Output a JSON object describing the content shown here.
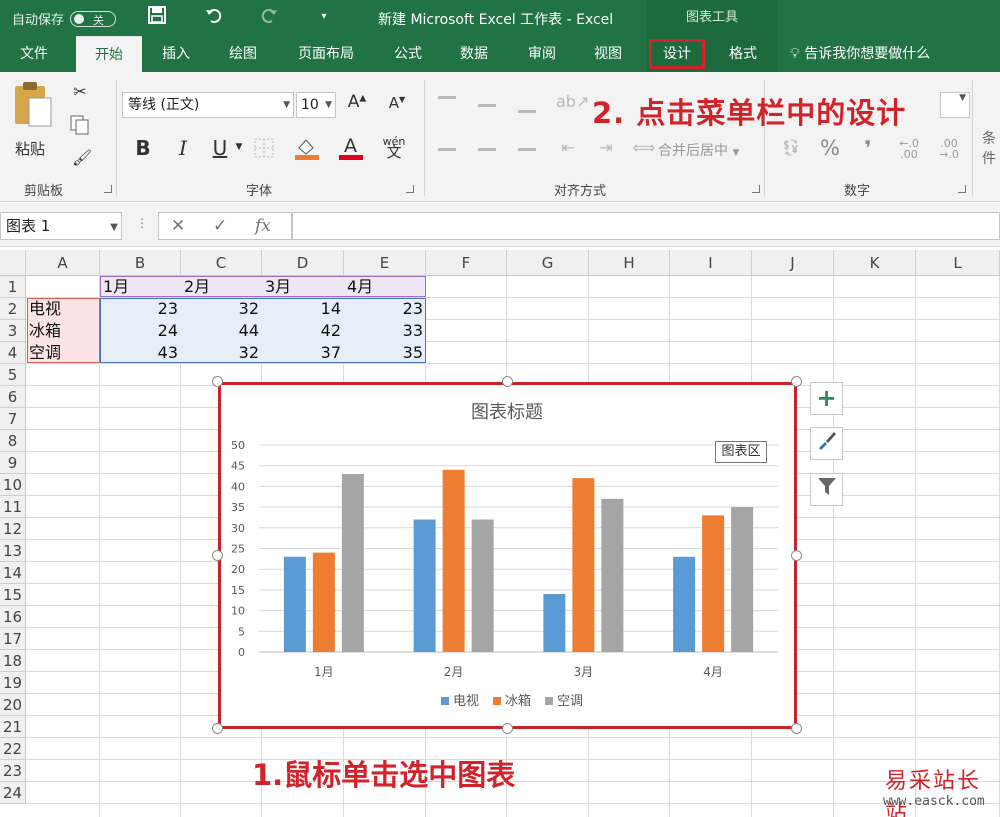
{
  "titlebar": {
    "autosave_label": "自动保存",
    "autosave_state": "关",
    "title": "新建 Microsoft Excel 工作表  -  Excel",
    "context_tools": "图表工具"
  },
  "menu": {
    "tabs": [
      "文件",
      "开始",
      "插入",
      "绘图",
      "页面布局",
      "公式",
      "数据",
      "审阅",
      "视图",
      "设计",
      "格式"
    ],
    "tell_me": "告诉我你想要做什么"
  },
  "ribbon": {
    "clipboard": {
      "paste": "粘贴",
      "label": "剪贴板"
    },
    "font": {
      "name": "等线 (正文)",
      "size": "10",
      "bold": "B",
      "italic": "I",
      "underline": "U",
      "phonetic": "wén",
      "phonetic_sub": "文",
      "label": "字体"
    },
    "alignment": {
      "merge": "合并后居中",
      "label": "对齐方式"
    },
    "number": {
      "percent": "%",
      "comma": "❜",
      "label": "数字"
    },
    "styles_partial": "条件"
  },
  "annotation_2": "2. 点击菜单栏中的设计",
  "formula_bar": {
    "name_box": "图表 1",
    "fx": "fx"
  },
  "grid": {
    "columns": [
      "A",
      "B",
      "C",
      "D",
      "E",
      "F",
      "G",
      "H",
      "I",
      "J",
      "K",
      "L"
    ],
    "rows": [
      "1",
      "2",
      "3",
      "4",
      "5",
      "6",
      "7",
      "8",
      "9",
      "10",
      "11",
      "12",
      "13",
      "14",
      "15",
      "16",
      "17",
      "18",
      "19",
      "20",
      "21",
      "22",
      "23",
      "24"
    ],
    "header_row": [
      "1月",
      "2月",
      "3月",
      "4月"
    ],
    "data_rows": [
      {
        "label": "电视",
        "values": [
          23,
          32,
          14,
          23
        ]
      },
      {
        "label": "冰箱",
        "values": [
          24,
          44,
          42,
          33
        ]
      },
      {
        "label": "空调",
        "values": [
          43,
          32,
          37,
          35
        ]
      }
    ]
  },
  "chart_data": {
    "type": "bar",
    "title": "图表标题",
    "categories": [
      "1月",
      "2月",
      "3月",
      "4月"
    ],
    "series": [
      {
        "name": "电视",
        "values": [
          23,
          32,
          14,
          23
        ],
        "color": "#5b9bd5"
      },
      {
        "name": "冰箱",
        "values": [
          24,
          44,
          42,
          33
        ],
        "color": "#ed7d31"
      },
      {
        "name": "空调",
        "values": [
          43,
          32,
          37,
          35
        ],
        "color": "#a5a5a5"
      }
    ],
    "ylim": [
      0,
      50
    ],
    "yticks": [
      0,
      5,
      10,
      15,
      20,
      25,
      30,
      35,
      40,
      45,
      50
    ],
    "grid": true,
    "legend": "bottom"
  },
  "chart_tooltip": "图表区",
  "annotation_1": "1.鼠标单击选中图表",
  "watermark": {
    "text": "易采站长站",
    "url": "www.easck.com"
  }
}
